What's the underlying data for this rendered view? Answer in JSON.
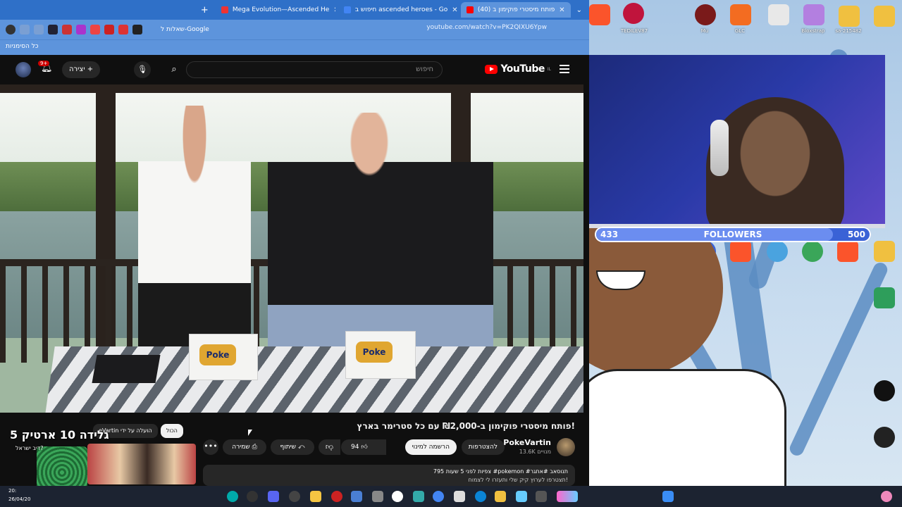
{
  "browser": {
    "tabs": [
      {
        "label": "(40) פותח מיסטרי פוקימון ב",
        "active": true,
        "icon_color": "#ff0000"
      },
      {
        "label": "חיפוש ב ascended heroes - Go",
        "active": false,
        "icon_color": "#4285f4"
      },
      {
        "label": "Mega Evolution—Ascended He",
        "active": false,
        "icon_color": "#e33"
      }
    ],
    "url": "youtube.com/watch?v=PK2QIXU6Ypw",
    "google_search_label": "שאלות ל-Google",
    "bookmarks_label": "כל הסימניות"
  },
  "youtube": {
    "logo_text": "YouTube",
    "logo_region": "IL",
    "search_placeholder": "חיפוש",
    "create_label": "יצירה",
    "notification_count": "9+",
    "video_title": "פותח מיסטרי פוקימון ב-₪2,000 עם כל סטרימר בארץ!",
    "channel_name": "PokeVartin",
    "channel_subs": "13.6K מנויים",
    "join_label": "להצטרפות",
    "subscribe_label": "הרשמה למינוי",
    "like_count": "94",
    "share_label": "שיתוף",
    "save_label": "שמירה",
    "more_label": "•••",
    "description_line1": "795 צפיות  לפני 5 שעות  #pokemon #תנוסאב #אתגר",
    "description_line2": "תצטרפו לערוץ קיק שלי ותעזרו לי לצמוח!",
    "chips": [
      {
        "label": "הכול",
        "selected": true
      },
      {
        "label": "eVartin הועלה על ידי",
        "selected": false
      }
    ],
    "box_logo": "Poke"
  },
  "ad": {
    "title": "גלידה 10 ארטיק 5",
    "subtitle": "דיב ישראל?"
  },
  "stream": {
    "followers_label": "FOLLOWERS",
    "followers_current": "433",
    "followers_goal": "500",
    "followers_progress": 0.866
  },
  "desktop_icons": [
    {
      "label": "Brave",
      "color": "#fb542b"
    },
    {
      "label": "TEDILEV87",
      "color": "#c0143c"
    },
    {
      "label": "Mu",
      "color": "#7a1a1a"
    },
    {
      "label": "GLC",
      "color": "#f36c21"
    },
    {
      "label": "Bloxstrap",
      "color": "#b37fe0"
    },
    {
      "label": "sa-215482",
      "color": "#f0c040"
    }
  ],
  "taskbar": {
    "time": "20:",
    "date": "26/04/20"
  }
}
